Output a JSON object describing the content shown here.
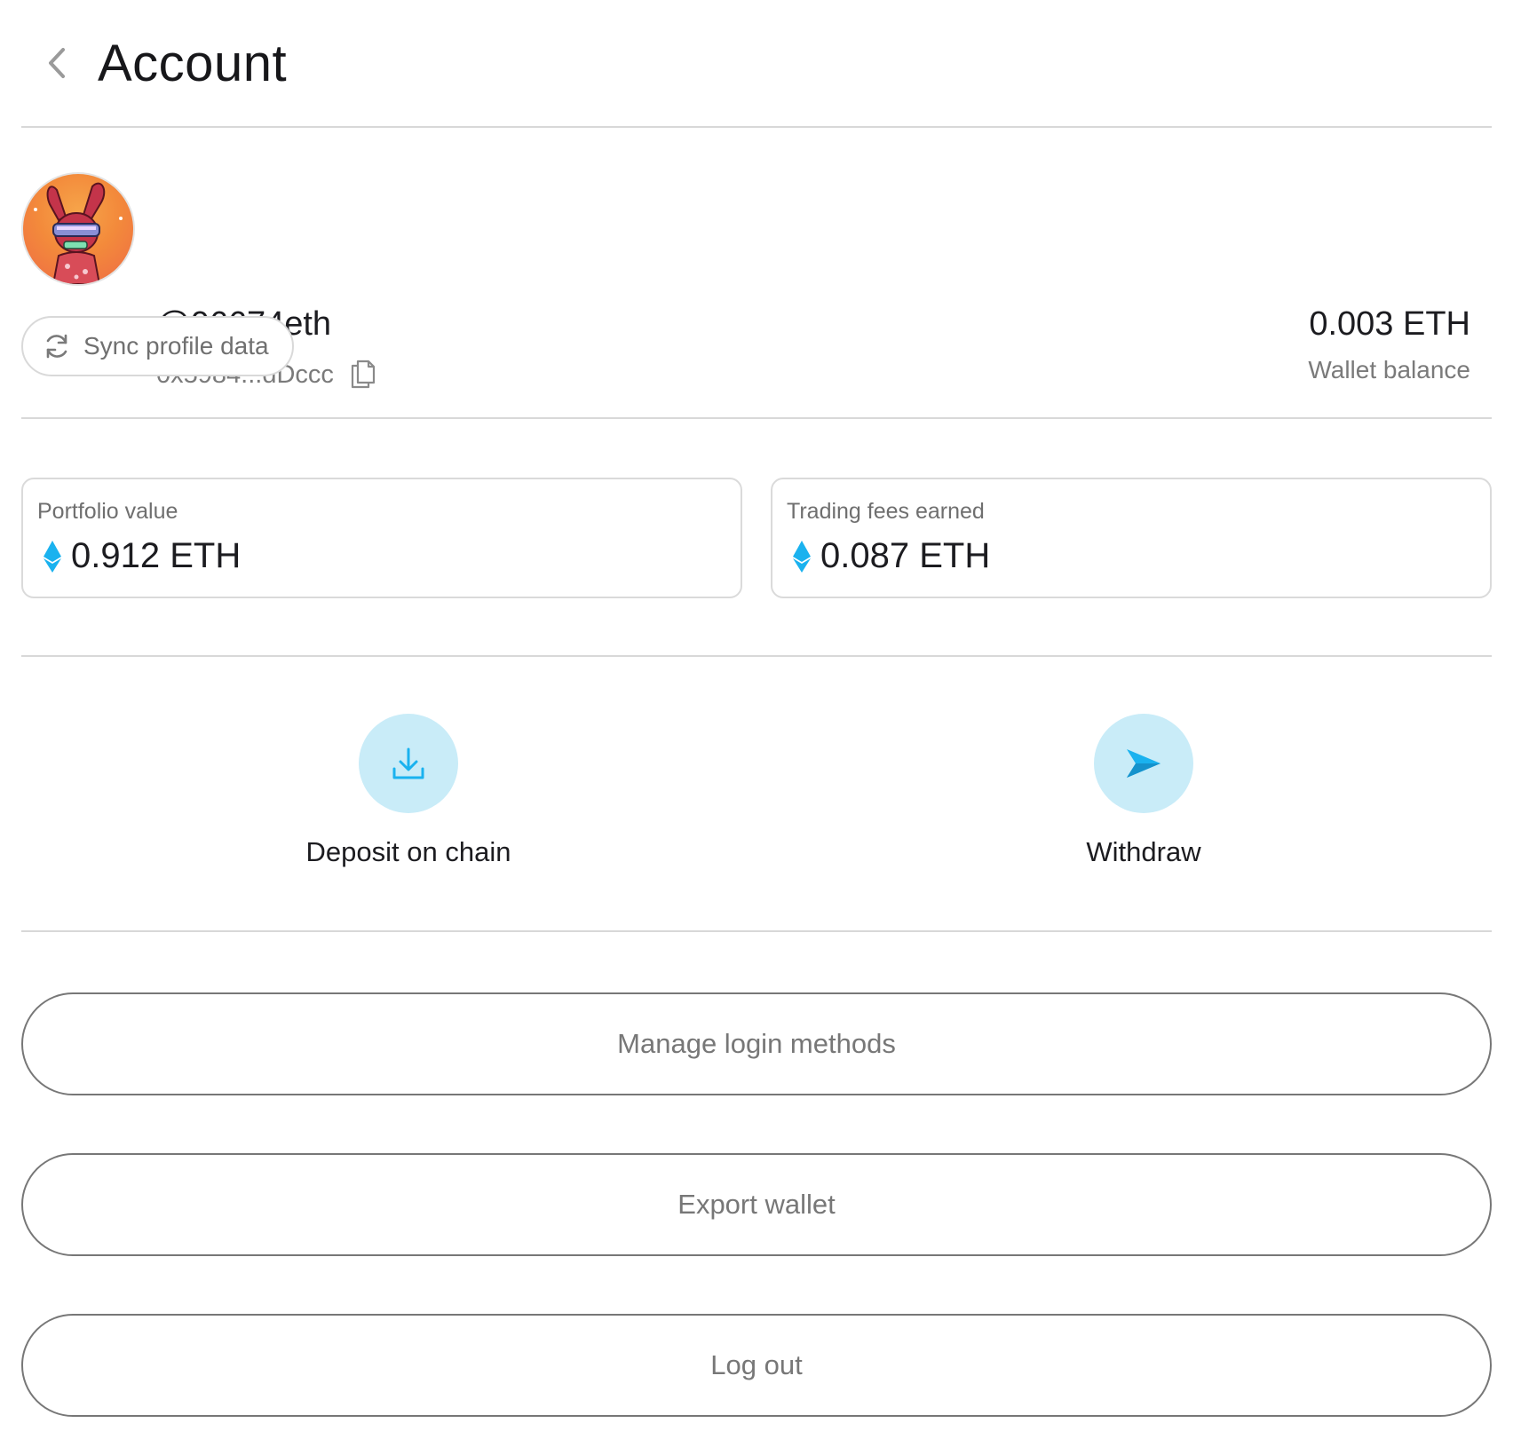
{
  "header": {
    "title": "Account"
  },
  "profile": {
    "username": "@06674eth",
    "address": "0x5984...dDccc",
    "wallet_balance_value": "0.003 ETH",
    "wallet_balance_label": "Wallet balance",
    "sync_label": "Sync profile data"
  },
  "stats": {
    "portfolio": {
      "label": "Portfolio value",
      "value": "0.912 ETH"
    },
    "fees": {
      "label": "Trading fees earned",
      "value": "0.087 ETH"
    }
  },
  "actions": {
    "deposit_label": "Deposit on chain",
    "withdraw_label": "Withdraw"
  },
  "menu": {
    "manage_login_label": "Manage login methods",
    "export_wallet_label": "Export wallet",
    "logout_label": "Log out"
  },
  "icons": {
    "back": "chevron-left-icon",
    "copy": "copy-icon",
    "sync": "refresh-icon",
    "eth": "ethereum-icon",
    "deposit": "download-icon",
    "withdraw": "send-icon"
  },
  "colors": {
    "accent": "#1ab2ef",
    "accent_light": "#c9ecf8",
    "divider": "#d8d8d8",
    "muted_text": "#7a7a7a"
  }
}
